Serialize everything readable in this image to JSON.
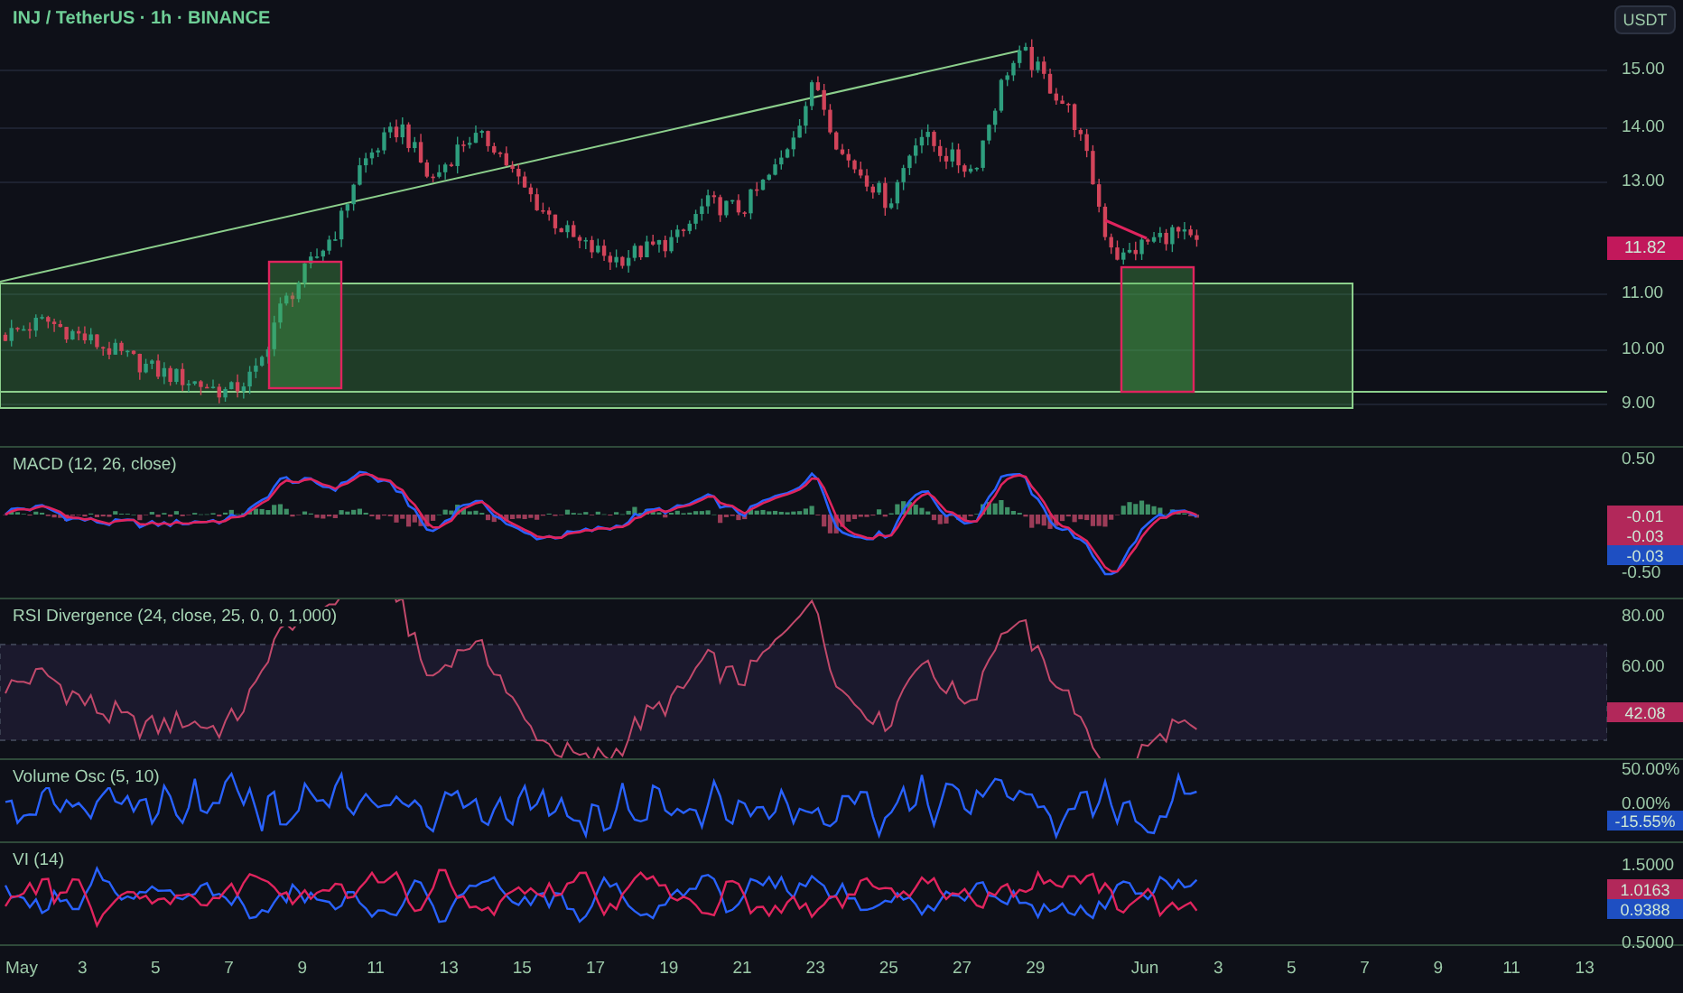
{
  "header": {
    "symbol_title": "INJ / TetherUS · 1h · BINANCE",
    "currency_button": "USDT"
  },
  "price_pane": {
    "axis_labels": [
      "15.00",
      "14.00",
      "13.00",
      "11.00",
      "10.00",
      "9.00"
    ],
    "last_price": {
      "text": "11.82",
      "color": "#c2185b"
    }
  },
  "panes": [
    {
      "kind": "macd",
      "legend": "MACD (12, 26, close)",
      "axis_labels": [
        "0.50",
        "-0.50"
      ],
      "value_badges": [
        {
          "text": "-0.01",
          "color": "#b2285a"
        },
        {
          "text": "-0.03",
          "color": "#b2285a"
        },
        {
          "text": "-0.03",
          "color": "#1e4fc2"
        }
      ]
    },
    {
      "kind": "rsi",
      "legend": "RSI Divergence (24, close, 25, 0, 0, 1,000)",
      "axis_labels": [
        "80.00",
        "60.00"
      ],
      "value_badges": [
        {
          "text": "42.08",
          "color": "#b2285a"
        }
      ]
    },
    {
      "kind": "volume",
      "legend": "Volume Osc (5, 10)",
      "axis_labels": [
        "50.00%",
        "0.00%"
      ],
      "value_badges": [
        {
          "text": "-15.55%",
          "color": "#1e4fc2"
        }
      ]
    },
    {
      "kind": "vi",
      "legend": "VI (14)",
      "axis_labels": [
        "1.5000",
        "0.5000"
      ],
      "value_badges": [
        {
          "text": "1.0163",
          "color": "#b2285a"
        },
        {
          "text": "0.9388",
          "color": "#1e4fc2"
        }
      ]
    }
  ],
  "time_axis": {
    "labels": [
      "May",
      "3",
      "5",
      "7",
      "9",
      "11",
      "13",
      "15",
      "17",
      "19",
      "21",
      "23",
      "25",
      "27",
      "29",
      "Jun",
      "3",
      "5",
      "7",
      "9",
      "11",
      "13"
    ]
  }
}
